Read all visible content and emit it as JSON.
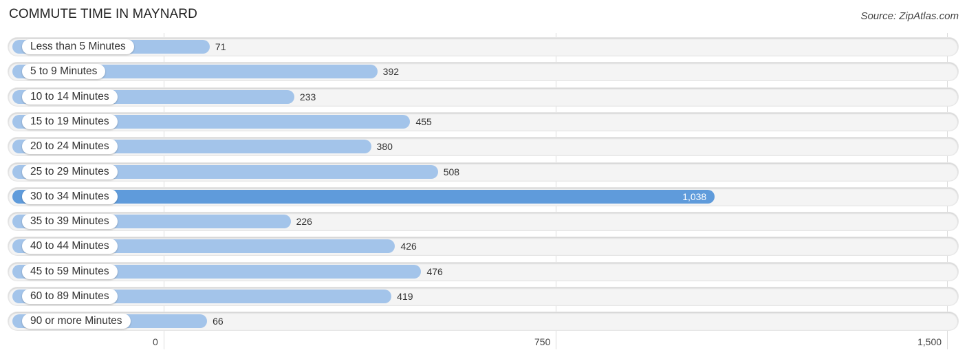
{
  "header": {
    "title": "COMMUTE TIME IN MAYNARD",
    "source": "Source: ZipAtlas.com"
  },
  "colors": {
    "bar": "#a3c4ea",
    "bar_highlight": "#5f9bdb",
    "track": "#f4f4f4"
  },
  "chart_data": {
    "type": "bar",
    "orientation": "horizontal",
    "title": "COMMUTE TIME IN MAYNARD",
    "xlabel": "",
    "ylabel": "",
    "xlim": [
      0,
      1500
    ],
    "xticks": [
      0,
      750,
      1500
    ],
    "xtick_labels": [
      "0",
      "750",
      "1,500"
    ],
    "grid": true,
    "categories": [
      "Less than 5 Minutes",
      "5 to 9 Minutes",
      "10 to 14 Minutes",
      "15 to 19 Minutes",
      "20 to 24 Minutes",
      "25 to 29 Minutes",
      "30 to 34 Minutes",
      "35 to 39 Minutes",
      "40 to 44 Minutes",
      "45 to 59 Minutes",
      "60 to 89 Minutes",
      "90 or more Minutes"
    ],
    "values": [
      71,
      392,
      233,
      455,
      380,
      508,
      1038,
      226,
      426,
      476,
      419,
      66
    ],
    "value_labels": [
      "71",
      "392",
      "233",
      "455",
      "380",
      "508",
      "1,038",
      "226",
      "426",
      "476",
      "419",
      "66"
    ],
    "highlight_index": 6
  }
}
